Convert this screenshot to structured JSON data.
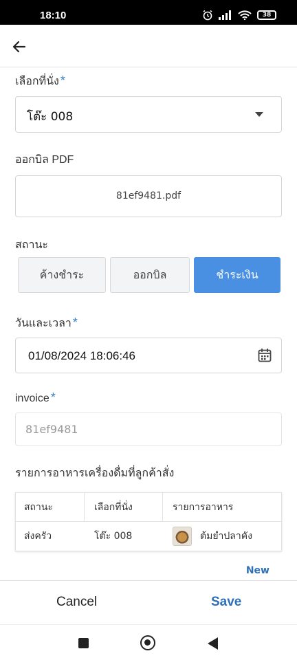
{
  "status": {
    "time": "18:10",
    "battery": "38"
  },
  "form": {
    "seat": {
      "label": "เลือกที่นั่ง",
      "required": "*",
      "value": "โต๊ะ 008"
    },
    "pdf": {
      "label": "ออกบิล PDF",
      "filename": "81ef9481.pdf"
    },
    "status": {
      "label": "สถานะ",
      "options": [
        "ค้างชำระ",
        "ออกบิล",
        "ชำระเงิน"
      ],
      "selected": "ชำระเงิน"
    },
    "datetime": {
      "label": "วันและเวลา",
      "required": "*",
      "value": "01/08/2024 18:06:46"
    },
    "invoice": {
      "label": "invoice",
      "required": "*",
      "value": "81ef9481"
    },
    "orders": {
      "label": "รายการอาหารเครื่องดื่มที่ลูกค้าสั่ง",
      "columns": [
        "สถานะ",
        "เลือกที่นั่ง",
        "รายการอาหาร"
      ],
      "rows": [
        {
          "status": "ส่งครัว",
          "seat": "โต๊ะ 008",
          "item": "ต้มยำปลาคัง"
        }
      ],
      "new_label": "New"
    }
  },
  "footer": {
    "cancel": "Cancel",
    "save": "Save"
  },
  "colors": {
    "accent": "#4a90e2",
    "link": "#2f6fb5",
    "required": "#3b82c4"
  }
}
